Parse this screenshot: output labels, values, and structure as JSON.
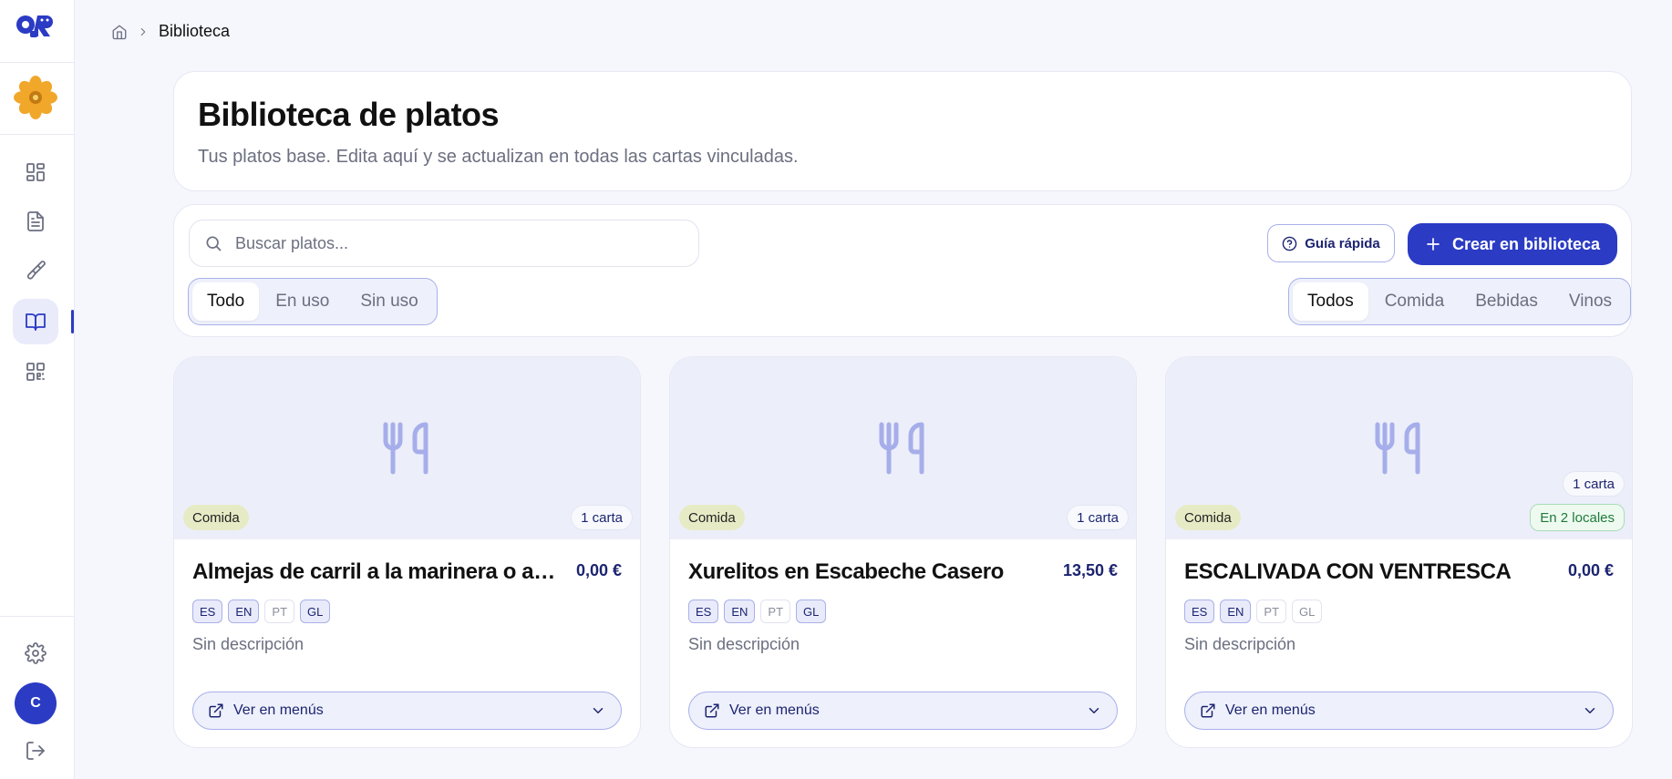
{
  "sidebar": {
    "logo_text": "QR",
    "nav": [
      {
        "name": "dashboard",
        "icon": "dashboard-icon"
      },
      {
        "name": "menus",
        "icon": "document-icon"
      },
      {
        "name": "design",
        "icon": "brush-icon"
      },
      {
        "name": "library",
        "icon": "book-icon",
        "active": true
      },
      {
        "name": "qr",
        "icon": "qr-code-icon"
      }
    ],
    "user_initial": "C"
  },
  "breadcrumb": {
    "current": "Biblioteca"
  },
  "header": {
    "title": "Biblioteca de platos",
    "subtitle": "Tus platos base. Edita aquí y se actualizan en todas las cartas vinculadas."
  },
  "filters": {
    "search_placeholder": "Buscar platos...",
    "usage_options": [
      "Todo",
      "En uso",
      "Sin uso"
    ],
    "usage_selected": "Todo",
    "guide_label": "Guía rápida",
    "create_label": "Crear en biblioteca",
    "type_options": [
      "Todos",
      "Comida",
      "Bebidas",
      "Vinos"
    ],
    "type_selected": "Todos"
  },
  "colors": {
    "accent": "#2b3bc4",
    "category_badge": "#e7ebc5"
  },
  "dishes": [
    {
      "category": "Comida",
      "menus_badge": "1 carta",
      "locales_badge": "",
      "name": "Almejas de carril a la marinera o a la plancha",
      "price": "0,00 €",
      "langs": [
        {
          "code": "ES",
          "on": true
        },
        {
          "code": "EN",
          "on": true
        },
        {
          "code": "PT",
          "on": false
        },
        {
          "code": "GL",
          "on": true
        }
      ],
      "description": "Sin descripción",
      "menus_button": "Ver en menús"
    },
    {
      "category": "Comida",
      "menus_badge": "1 carta",
      "locales_badge": "",
      "name": "Xurelitos en Escabeche Casero",
      "price": "13,50 €",
      "langs": [
        {
          "code": "ES",
          "on": true
        },
        {
          "code": "EN",
          "on": true
        },
        {
          "code": "PT",
          "on": false
        },
        {
          "code": "GL",
          "on": true
        }
      ],
      "description": "Sin descripción",
      "menus_button": "Ver en menús"
    },
    {
      "category": "Comida",
      "menus_badge": "1 carta",
      "locales_badge": "En 2 locales",
      "name": "ESCALIVADA CON VENTRESCA",
      "price": "0,00 €",
      "langs": [
        {
          "code": "ES",
          "on": true
        },
        {
          "code": "EN",
          "on": true
        },
        {
          "code": "PT",
          "on": false
        },
        {
          "code": "GL",
          "on": false
        }
      ],
      "description": "Sin descripción",
      "menus_button": "Ver en menús"
    }
  ]
}
